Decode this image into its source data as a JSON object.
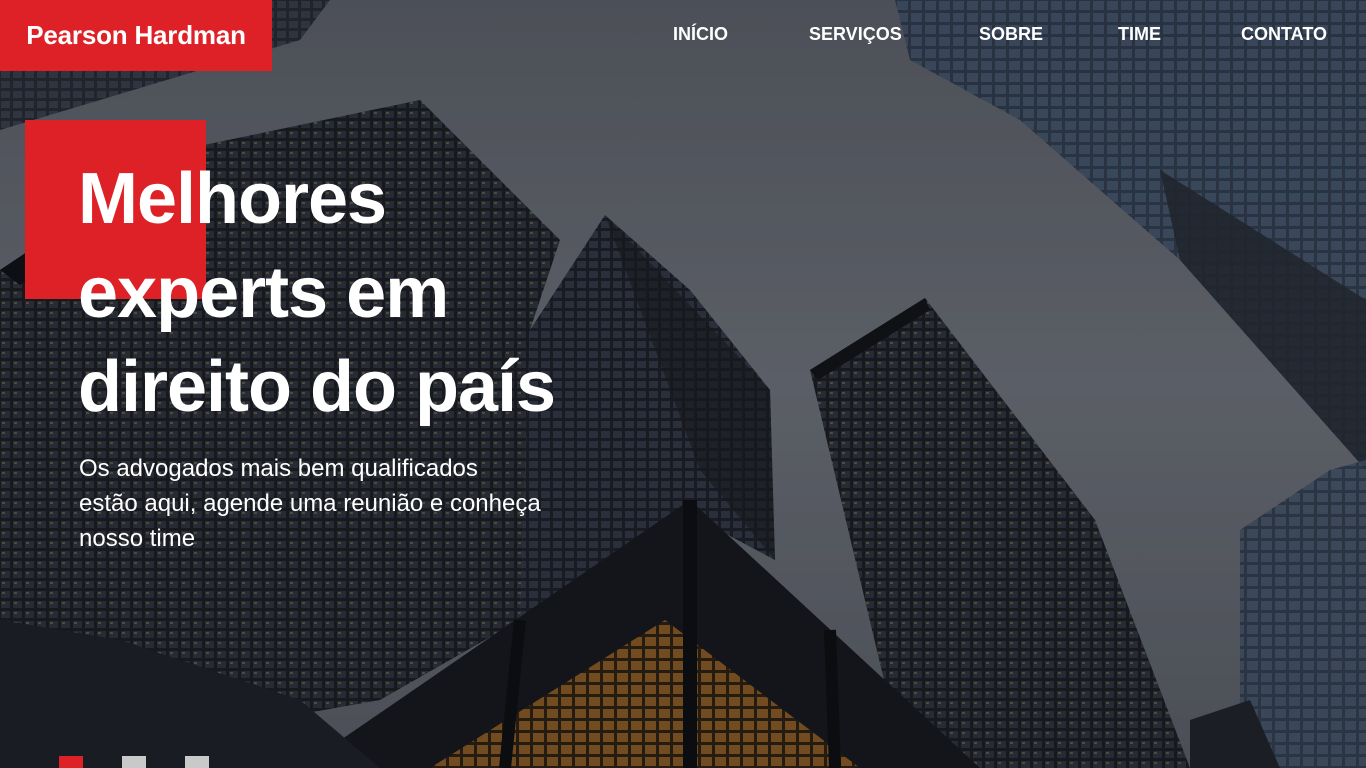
{
  "brand": {
    "name": "Pearson Hardman",
    "color": "#de2127"
  },
  "nav": {
    "items": [
      {
        "label": "INÍCIO"
      },
      {
        "label": "SERVIÇOS"
      },
      {
        "label": "SOBRE"
      },
      {
        "label": "TIME"
      },
      {
        "label": "CONTATO"
      }
    ]
  },
  "hero": {
    "background": "skyscrapers-photo",
    "headline_lines": [
      "Melhores",
      "experts em",
      "direito do país"
    ],
    "subtext_lines": [
      "Os advogados mais bem qualificados",
      "estão aqui, agende uma reunião e conheça",
      "nosso time"
    ]
  },
  "slider": {
    "dots": [
      {
        "state": "active",
        "color": "#de2127"
      },
      {
        "state": "inactive",
        "color": "#c9c9c9"
      },
      {
        "state": "inactive",
        "color": "#c9c9c9"
      }
    ]
  }
}
